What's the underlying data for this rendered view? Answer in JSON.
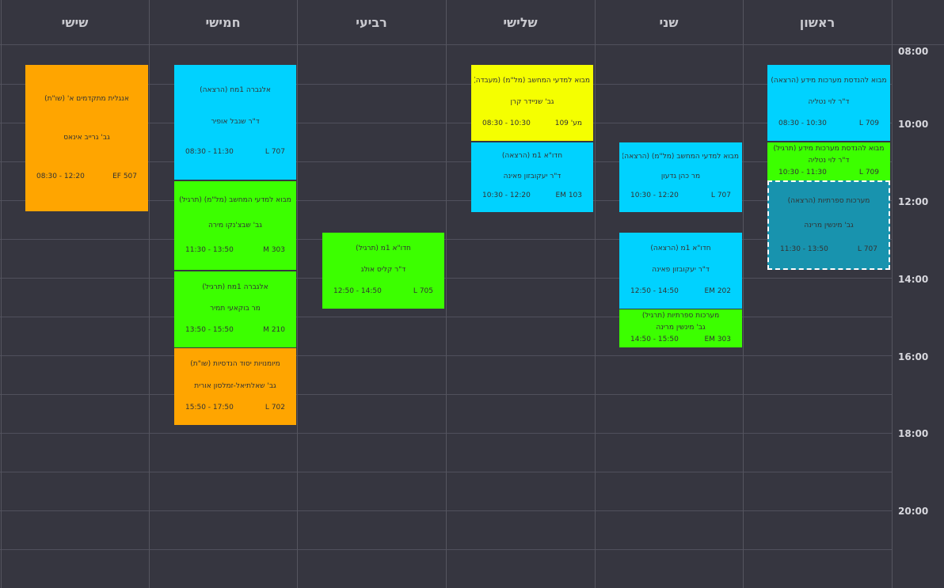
{
  "days": [
    "ראשון",
    "שני",
    "שלישי",
    "רביעי",
    "חמישי",
    "שישי"
  ],
  "hours": [
    "08:00",
    "10:00",
    "12:00",
    "14:00",
    "16:00",
    "18:00",
    "20:00"
  ],
  "colors": {
    "lecture": "#00d2ff",
    "exercise": "#3cff00",
    "orange": "#ffa500",
    "lab": "#f5ff00",
    "selected": "#1893ae",
    "background": "#363640"
  },
  "events": [
    {
      "day": "ראשון",
      "title": "מבוא להנדסת מערכות מידע (הרצאה)",
      "lecturer": "ד\"ר לוי נטליה",
      "room": "709 L",
      "time": "08:30 - 10:30",
      "color": "cyan"
    },
    {
      "day": "ראשון",
      "title": "מבוא להנדסת מערכות מידע (תרגיל)",
      "lecturer": "ד\"ר לוי נטליה",
      "room": "709 L",
      "time": "10:30 - 11:30",
      "color": "green"
    },
    {
      "day": "ראשון",
      "title": "מערכות ספרתיות (הרצאה)",
      "lecturer": "גב' מינשין מרינה",
      "room": "707 L",
      "time": "11:30 - 13:50",
      "color": "selected"
    },
    {
      "day": "שני",
      "title": "מבוא למדעי המחשב (מל\"מ) (הרצאה)",
      "lecturer": "מר כהן גדעון",
      "room": "707 L",
      "time": "10:30 - 12:20",
      "color": "cyan"
    },
    {
      "day": "שני",
      "title": "חדו\"א 1מ (הרצאה)",
      "lecturer": "ד\"ר יעקובזון פאינה",
      "room": "202 EM",
      "time": "12:50 - 14:50",
      "color": "cyan"
    },
    {
      "day": "שני",
      "title": "מערכות ספרתיות (תרגיל)",
      "lecturer": "גב' מינשין מרינה",
      "room": "303 EM",
      "time": "14:50 - 15:50",
      "color": "green"
    },
    {
      "day": "שלישי",
      "title": "מבוא למדעי המחשב (מל\"מ) (מעבדה)",
      "lecturer": "גב' שניידר קרן",
      "room": "מע' 109",
      "time": "08:30 - 10:30",
      "color": "yellow"
    },
    {
      "day": "שלישי",
      "title": "חדו\"א 1מ (הרצאה)",
      "lecturer": "ד\"ר יעקובזון פאינה",
      "room": "103 EM",
      "time": "10:30 - 12:20",
      "color": "cyan"
    },
    {
      "day": "רביעי",
      "title": "חדו\"א 1מ (תרגיל)",
      "lecturer": "ד\"ר קליס אולג",
      "room": "705 L",
      "time": "12:50 - 14:50",
      "color": "green"
    },
    {
      "day": "חמישי",
      "title": "אלגברה 1מח (הרצאה)",
      "lecturer": "ד\"ר שנבל אופיר",
      "room": "707 L",
      "time": "08:30 - 11:30",
      "color": "cyan"
    },
    {
      "day": "חמישי",
      "title": "מבוא למדעי המחשב (מל\"מ) (תרגיל)",
      "lecturer": "גב' שבצ'נקו מירה",
      "room": "303 M",
      "time": "11:30 - 13:50",
      "color": "green"
    },
    {
      "day": "חמישי",
      "title": "אלגברה 1מח (תרגיל)",
      "lecturer": "מר בוקאעי תמיר",
      "room": "210 M",
      "time": "13:50 - 15:50",
      "color": "green"
    },
    {
      "day": "חמישי",
      "title": "מיומנויות יסוד הנדסיות (שו\"ת)",
      "lecturer": "גב' שאלתיאל-זמלסון אורית",
      "room": "702 L",
      "time": "15:50 - 17:50",
      "color": "orange"
    },
    {
      "day": "שישי",
      "title": "אנגלית מתקדמים א' (שו\"ת)",
      "lecturer": "גב' גרייב אינאס",
      "room": "507 EF",
      "time": "08:30 - 12:20",
      "color": "orange"
    }
  ]
}
